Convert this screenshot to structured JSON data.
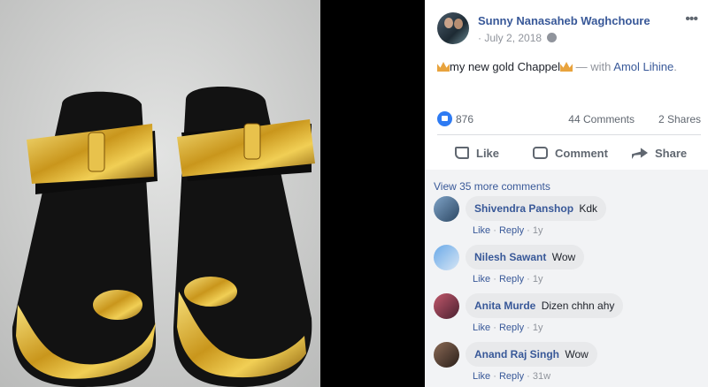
{
  "post": {
    "author": "Sunny Nanasaheb Waghchoure",
    "date": "July 2, 2018",
    "date_sep": "·",
    "caption_text": "my new gold Chappel",
    "caption_with": " — with ",
    "tagged": "Amol Lihine",
    "caption_end": ".",
    "more_icon": "•••"
  },
  "stats": {
    "reactions": "876",
    "comments": "44 Comments",
    "shares": "2 Shares"
  },
  "actions": {
    "like": "Like",
    "comment": "Comment",
    "share": "Share"
  },
  "comments_section": {
    "view_more": "View 35 more comments",
    "items": [
      {
        "name": "Shivendra Panshop",
        "text": "Kdk",
        "like": "Like",
        "reply": "Reply",
        "sep": " · ",
        "age": "1y"
      },
      {
        "name": "Nilesh Sawant",
        "text": "Wow",
        "like": "Like",
        "reply": "Reply",
        "sep": " · ",
        "age": "1y"
      },
      {
        "name": "Anita Murde",
        "text": "Dizen chhn ahy",
        "like": "Like",
        "reply": "Reply",
        "sep": " · ",
        "age": "1y"
      },
      {
        "name": "Anand Raj Singh",
        "text": "Wow",
        "like": "Like",
        "reply": "Reply",
        "sep": " · ",
        "age": "31w"
      }
    ]
  },
  "colors": {
    "link": "#385898",
    "accent_like": "#2e7bf3",
    "gold": "#d4a21a",
    "sandal": "#111111"
  },
  "icons": [
    "more-options-icon",
    "globe-icon",
    "crown-emoji-icon",
    "like-reaction-icon",
    "like-icon",
    "comment-icon",
    "share-icon"
  ]
}
